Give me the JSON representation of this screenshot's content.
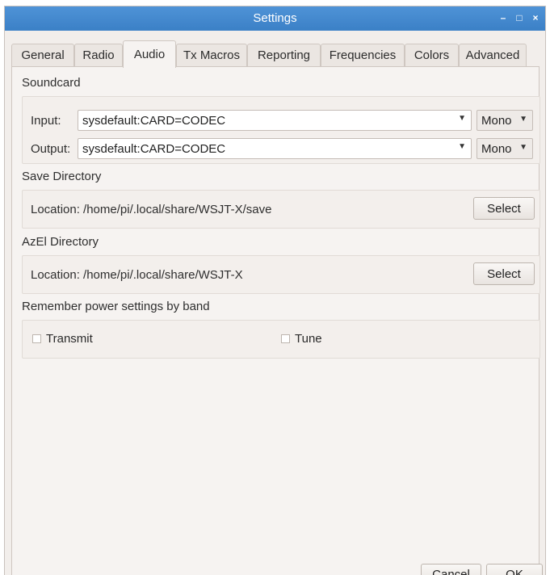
{
  "window": {
    "title": "Settings",
    "controls": {
      "minimize": "–",
      "maximize": "□",
      "close": "×"
    }
  },
  "tabs": [
    {
      "label": "General"
    },
    {
      "label": "Radio"
    },
    {
      "label": "Audio"
    },
    {
      "label": "Tx Macros"
    },
    {
      "label": "Reporting"
    },
    {
      "label": "Frequencies"
    },
    {
      "label": "Colors"
    },
    {
      "label": "Advanced"
    }
  ],
  "active_tab": "Audio",
  "soundcard": {
    "heading": "Soundcard",
    "input_label": "Input:",
    "input_value": "sysdefault:CARD=CODEC",
    "input_channel": "Mono",
    "output_label": "Output:",
    "output_value": "sysdefault:CARD=CODEC",
    "output_channel": "Mono"
  },
  "save_directory": {
    "heading": "Save Directory",
    "location_text": "Location:  /home/pi/.local/share/WSJT-X/save",
    "button": "Select"
  },
  "azel_directory": {
    "heading": "AzEl Directory",
    "location_text": "Location:  /home/pi/.local/share/WSJT-X",
    "button": "Select"
  },
  "power_settings": {
    "heading": "Remember power settings by band",
    "transmit_label": "Transmit",
    "tune_label": "Tune"
  },
  "footer": {
    "cancel": "Cancel",
    "ok": "OK"
  },
  "colors": {
    "titlebar": "#3b80c6",
    "window_bg": "#f2eeeb",
    "pane_bg": "#f6f3f1"
  }
}
